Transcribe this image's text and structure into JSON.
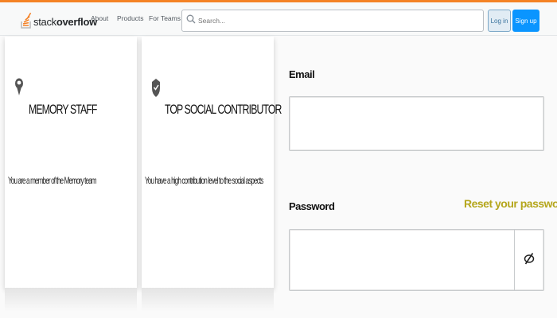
{
  "header": {
    "logo_text_light": "stack",
    "logo_text_bold": "overflow",
    "nav": [
      "About",
      "Products",
      "For Teams"
    ],
    "search_placeholder": "Search...",
    "login_label": "Log in",
    "signup_label": "Sign up",
    "accent_color": "#f48225",
    "primary_color": "#0a95ff"
  },
  "badges": [
    {
      "icon": "memory-badge-icon",
      "title": "MEMORY STAFF",
      "description": "You are a member of the Memory team"
    },
    {
      "icon": "check-shield-icon",
      "title": "TOP SOCIAL CONTRIBUTOR",
      "description": "You have a high contribution level to the social aspects"
    }
  ],
  "form": {
    "email_label": "Email",
    "email_value": "",
    "password_label": "Password",
    "password_value": "",
    "reset_link": "Reset your password?",
    "reset_color": "#b5a61c",
    "toggle_icon": "eye-slash-icon"
  }
}
